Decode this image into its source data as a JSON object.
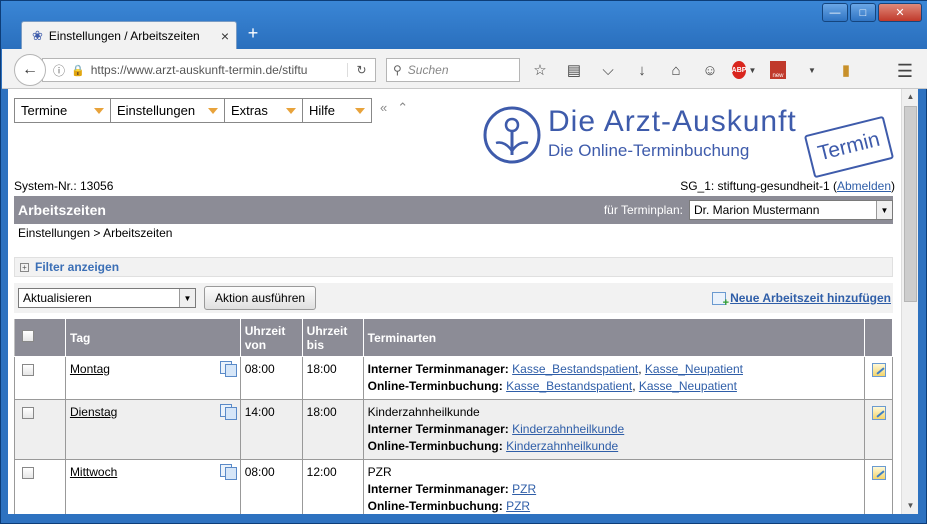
{
  "browser": {
    "tab_title": "Einstellungen / Arbeitszeiten",
    "url": "https://www.arzt-auskunft-termin.de/stiftu",
    "search_placeholder": "Suchen"
  },
  "app_menu": {
    "items": [
      {
        "label": "Termine"
      },
      {
        "label": "Einstellungen"
      },
      {
        "label": "Extras"
      },
      {
        "label": "Hilfe"
      }
    ],
    "collapse_left": "«",
    "collapse_up": "⌃"
  },
  "logo": {
    "title": "Die Arzt-Auskunft",
    "subtitle": "Die Online-Terminbuchung",
    "stamp": "Termin"
  },
  "header": {
    "system_nr": "System-Nr.: 13056",
    "user": "SG_1: stiftung-gesundheit-1 (",
    "logout": "Abmelden",
    "user_close": ")"
  },
  "section": {
    "title": "Arbeitszeiten",
    "terminplan_label": "für Terminplan:",
    "terminplan_value": "Dr. Marion Mustermann"
  },
  "breadcrumb": "Einstellungen > Arbeitszeiten",
  "filter": {
    "label": "Filter anzeigen"
  },
  "actions": {
    "select_value": "Aktualisieren",
    "execute_button": "Aktion ausführen",
    "new_link": "Neue Arbeitszeit hinzufügen"
  },
  "table": {
    "headers": {
      "tag": "Tag",
      "von": "Uhrzeit von",
      "bis": "Uhrzeit bis",
      "arten": "Terminarten"
    },
    "rows": [
      {
        "day": "Montag",
        "from": "08:00",
        "to": "18:00",
        "plain": "",
        "internal_label": "Interner Terminmanager:",
        "internal_links": [
          "Kasse_Bestandspatient",
          "Kasse_Neupatient"
        ],
        "online_label": "Online-Terminbuchung:",
        "online_links": [
          "Kasse_Bestandspatient",
          "Kasse_Neupatient"
        ]
      },
      {
        "day": "Dienstag",
        "from": "14:00",
        "to": "18:00",
        "plain": "Kinderzahnheilkunde",
        "internal_label": "Interner Terminmanager:",
        "internal_links": [
          "Kinderzahnheilkunde"
        ],
        "online_label": "Online-Terminbuchung:",
        "online_links": [
          "Kinderzahnheilkunde"
        ]
      },
      {
        "day": "Mittwoch",
        "from": "08:00",
        "to": "12:00",
        "plain": "PZR",
        "internal_label": "Interner Terminmanager:",
        "internal_links": [
          "PZR"
        ],
        "online_label": "Online-Terminbuchung:",
        "online_links": [
          "PZR"
        ]
      }
    ]
  }
}
